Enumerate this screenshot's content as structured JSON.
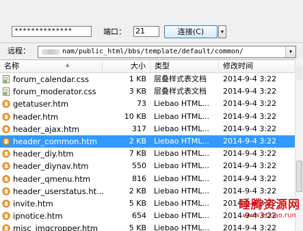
{
  "connection": {
    "password_masked": "**************",
    "port_label": "端口：",
    "port": "21",
    "connect_label": "连接(C)",
    "connect_dropdown": "▾"
  },
  "remote": {
    "label": "远程：",
    "path_visible": "nam/public_html/bbs/template/default/common/",
    "dropdown": "▾"
  },
  "columns": {
    "name": "名称",
    "size": "大小",
    "type": "类型",
    "modified": "修改时间",
    "sort_indicator": "▲"
  },
  "files": [
    {
      "name": "forum_calendar.css",
      "size": "1 KB",
      "type": "层叠样式表文档",
      "modified": "2014-9-4 3:22",
      "icon": "css-file-icon",
      "selected": false
    },
    {
      "name": "forum_moderator.css",
      "size": "3 KB",
      "type": "层叠样式表文档",
      "modified": "2014-9-4 3:22",
      "icon": "css-file-icon",
      "selected": false
    },
    {
      "name": "getatuser.htm",
      "size": "73",
      "type": "Liebao HTML...",
      "modified": "2014-9-4 3:22",
      "icon": "html-file-icon",
      "selected": false
    },
    {
      "name": "header.htm",
      "size": "10 KB",
      "type": "Liebao HTML...",
      "modified": "2014-9-4 3:22",
      "icon": "html-file-icon",
      "selected": false
    },
    {
      "name": "header_ajax.htm",
      "size": "317",
      "type": "Liebao HTML...",
      "modified": "2014-9-4 3:22",
      "icon": "html-file-icon",
      "selected": false
    },
    {
      "name": "header_common.htm",
      "size": "2 KB",
      "type": "Liebao HTML...",
      "modified": "2014-9-4 3:22",
      "icon": "html-file-icon",
      "selected": true
    },
    {
      "name": "header_diy.htm",
      "size": "7 KB",
      "type": "Liebao HTML...",
      "modified": "2014-9-4 3:22",
      "icon": "html-file-icon",
      "selected": false
    },
    {
      "name": "header_diynav.htm",
      "size": "550",
      "type": "Liebao HTML...",
      "modified": "2014-9-4 3:22",
      "icon": "html-file-icon",
      "selected": false
    },
    {
      "name": "header_qmenu.htm",
      "size": "816",
      "type": "Liebao HTML...",
      "modified": "2014-9-4 3:22",
      "icon": "html-file-icon",
      "selected": false
    },
    {
      "name": "header_userstatus.ht...",
      "size": "2 KB",
      "type": "Liebao HTML...",
      "modified": "2014-9-4 3:22",
      "icon": "html-file-icon",
      "selected": false
    },
    {
      "name": "invite.htm",
      "size": "5 KB",
      "type": "Liebao HTML...",
      "modified": "2014-9-4 3:22",
      "icon": "html-file-icon",
      "selected": false
    },
    {
      "name": "ipnotice.htm",
      "size": "654",
      "type": "Liebao HTML...",
      "modified": "2014-9-4 3:22",
      "icon": "html-file-icon",
      "selected": false
    },
    {
      "name": "misc_imgcropper.htm",
      "size": "5 KB",
      "type": "Liebao HTML...",
      "modified": "2014-9-4 3:22",
      "icon": "html-file-icon",
      "selected": false
    }
  ],
  "watermark": {
    "line1": "睡腾资源网",
    "line2": "www.etxiao.run"
  },
  "colors": {
    "selection": "#3399ff",
    "watermark": "#d7191e"
  }
}
